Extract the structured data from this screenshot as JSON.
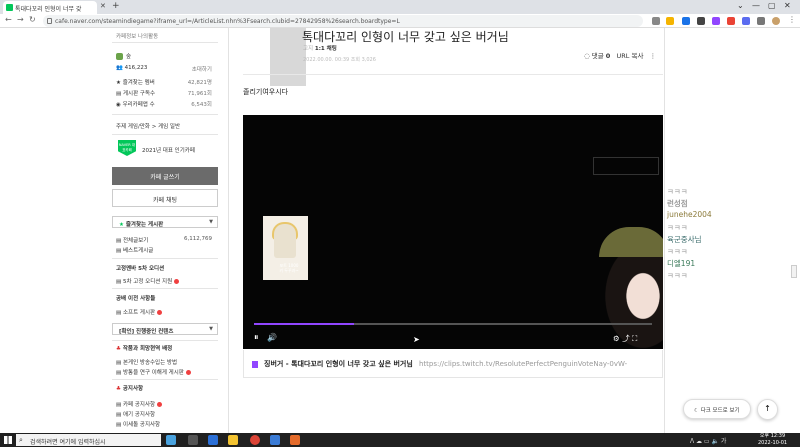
{
  "browser": {
    "tab_title": "톡대다꼬리 인형이 너무 갖",
    "url": "cafe.naver.com/steamindiegame?iframe_url=/ArticleList.nhn%3Fsearch.clubid=27842958%26search.boardtype=L"
  },
  "sidebar": {
    "top_links": "카페정보   나의활동",
    "rank_label": "숲",
    "members_count": "416,223",
    "invite_label": "초대하기",
    "stats": [
      {
        "label": "즐겨찾는 멤버",
        "value": "42,821명"
      },
      {
        "label": "게시판 구독수",
        "value": "71,961회"
      },
      {
        "label": "우리카페앱 수",
        "value": "6,543회"
      }
    ],
    "topic": "주제  게임/만화 > 게임 일반",
    "award": "2021년 대표 인기카페",
    "naver_badge": "NAVER 대표카페",
    "write_button": "카페 글쓰기",
    "chat_button": "카페 채팅",
    "favorites_header": "즐겨찾는 게시판",
    "menu_all": "전체글보기",
    "menu_all_count": "6,112,769",
    "menu_best": "베스트게시글",
    "section1_header": "고정멘바 5차 오디션",
    "section1_item": "5차 고정 오디션 지원",
    "section2_header": "공배 이전 사항들",
    "section2_item": "소프트 게시판",
    "section3_header": "[확인] 진행중인 컨텐츠",
    "section4_header": "작품과 희망현역 배정",
    "section4_items": [
      "본게인 방송수입는 방법",
      "방통을 연구 이해게 게시판"
    ],
    "notice_header": "공지사항",
    "notice_items": [
      "카페 공지사항",
      "애기 공지사항",
      "이세돌 공지사항"
    ]
  },
  "post": {
    "title": "톡대다꼬리 인형이 너무 갖고 싶은 버거님",
    "author_meta": "고지",
    "author_grade": "1:1 채팅",
    "date": "2022.00.00. 00:39  조회 3,026",
    "comments_label": "댓글",
    "comments_count": "0",
    "url_copy": "URL 복사",
    "more": "⋮",
    "body_text": "졸리기여우시다"
  },
  "video": {
    "progress": 0.25,
    "char_label_line1": "포트 1000",
    "char_label_line2": "키 두꾸과~",
    "overlay_text": "",
    "overlay_box_text": "",
    "play_icon": "⏸",
    "vol_icon": "🔊",
    "controls": "⚙  ⤴  ⛶"
  },
  "link_card": {
    "title": "징버거 - 톡대다꼬리 인형이 너무 갖고 싶은 버거님",
    "url": "https://clips.twitch.tv/ResolutePerfectPenguinVoteNay-0vW-"
  },
  "chat": [
    {
      "text": "ㅋㅋㅋ",
      "color": "#bbbbbb"
    },
    {
      "text": "런성점",
      "color": "#9a9a9a"
    },
    {
      "text": "junehe2004",
      "color": "#8b7a3a"
    },
    {
      "text": "ㅋㅋㅋ",
      "color": "#bbbbbb"
    },
    {
      "text": "육군중사님",
      "color": "#3a6b6b"
    },
    {
      "text": "ㅋㅋㅋ",
      "color": "#bbbbbb"
    },
    {
      "text": "디엘191",
      "color": "#3a7a5a"
    },
    {
      "text": "ㅋㅋㅋ",
      "color": "#bbbbbb"
    }
  ],
  "floating": {
    "dark_mode": "다크 모드로 보기",
    "to_top": "↑"
  },
  "taskbar": {
    "search_placeholder": "검색하려면 여기에 입력하십시",
    "tray": "ᐱ  ☁  ▭  🔈  가",
    "time": "오후 12:39",
    "date": "2022-10-01"
  },
  "colors": {
    "naver_green": "#03c75a",
    "twitch_purple": "#9146ff"
  }
}
